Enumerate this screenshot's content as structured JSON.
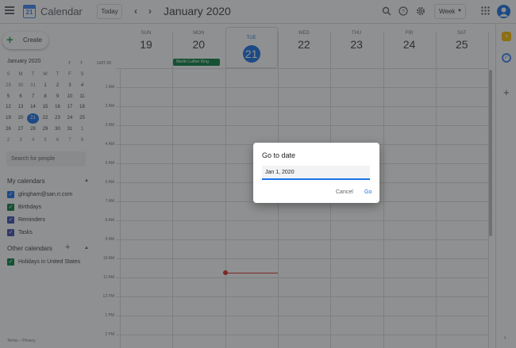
{
  "header": {
    "app_name": "Calendar",
    "logo_day": "21",
    "today_label": "Today",
    "prev_icon": "‹",
    "next_icon": "›",
    "month_title": "January 2020",
    "view_label": "Week"
  },
  "sidebar": {
    "create_label": "Create",
    "mini_title": "January 2020",
    "weekday_initials": [
      "S",
      "M",
      "T",
      "W",
      "T",
      "F",
      "S"
    ],
    "weeks": [
      [
        "29",
        "30",
        "31",
        "1",
        "2",
        "3",
        "4"
      ],
      [
        "5",
        "6",
        "7",
        "8",
        "9",
        "10",
        "11"
      ],
      [
        "12",
        "13",
        "14",
        "15",
        "16",
        "17",
        "18"
      ],
      [
        "19",
        "20",
        "21",
        "22",
        "23",
        "24",
        "25"
      ],
      [
        "26",
        "27",
        "28",
        "29",
        "30",
        "31",
        "1"
      ],
      [
        "2",
        "3",
        "4",
        "5",
        "6",
        "7",
        "8"
      ]
    ],
    "selected_day": "21",
    "search_placeholder": "Search for people",
    "my_calendars_label": "My calendars",
    "my_calendars": [
      {
        "name": "glingham@san.rr.com",
        "color": "#1a73e8"
      },
      {
        "name": "Birthdays",
        "color": "#0b8043"
      },
      {
        "name": "Reminders",
        "color": "#3f51b5"
      },
      {
        "name": "Tasks",
        "color": "#3f51b5"
      }
    ],
    "other_calendars_label": "Other calendars",
    "other_calendars": [
      {
        "name": "Holidays in United States",
        "color": "#0b8043"
      }
    ],
    "footer_terms": "Terms",
    "footer_sep": "–",
    "footer_privacy": "Privacy"
  },
  "grid": {
    "timezone": "GMT-08",
    "days": [
      {
        "dow": "SUN",
        "num": "19"
      },
      {
        "dow": "MON",
        "num": "20"
      },
      {
        "dow": "TUE",
        "num": "21"
      },
      {
        "dow": "WED",
        "num": "22"
      },
      {
        "dow": "THU",
        "num": "23"
      },
      {
        "dow": "FRI",
        "num": "24"
      },
      {
        "dow": "SAT",
        "num": "25"
      }
    ],
    "times": [
      "1 AM",
      "2 AM",
      "3 AM",
      "4 AM",
      "5 AM",
      "6 AM",
      "7 AM",
      "8 AM",
      "9 AM",
      "10 AM",
      "11 AM",
      "12 PM",
      "1 PM",
      "2 PM"
    ],
    "all_day_event": "Martin Luther King"
  },
  "dialog": {
    "title": "Go to date",
    "input_value": "Jan 1, 2020",
    "cancel_label": "Cancel",
    "go_label": "Go"
  },
  "colors": {
    "accent": "#1a73e8",
    "event_green": "#0b8043",
    "now_line": "#d93025"
  }
}
